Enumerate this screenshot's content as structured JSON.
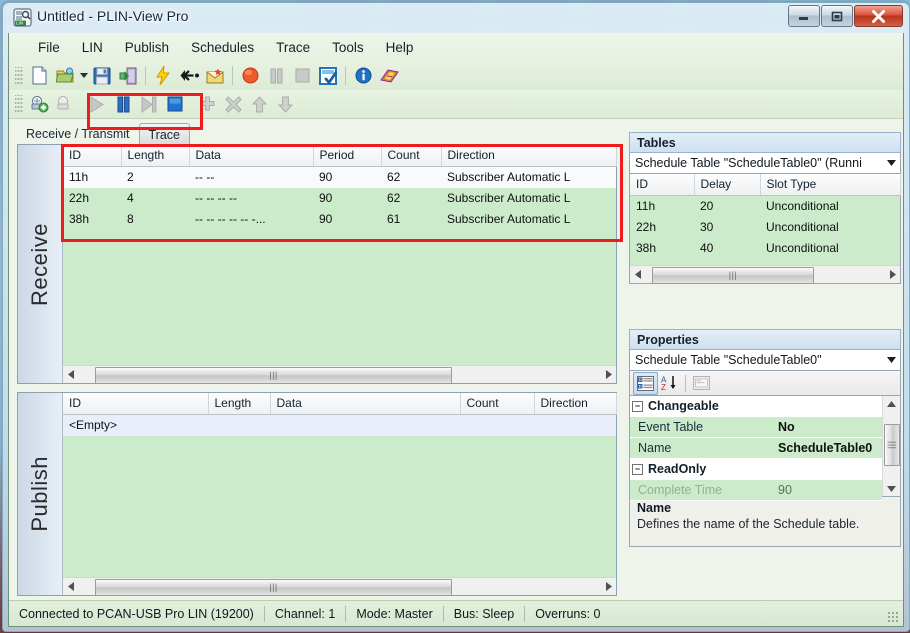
{
  "window": {
    "title": "Untitled - PLIN-View Pro",
    "app_icon": "plin-app-icon",
    "minimize_label": "Minimize",
    "maximize_label": "Maximize",
    "close_label": "Close"
  },
  "menubar": {
    "items": [
      {
        "label": "File"
      },
      {
        "label": "LIN"
      },
      {
        "label": "Publish"
      },
      {
        "label": "Schedules"
      },
      {
        "label": "Trace"
      },
      {
        "label": "Tools"
      },
      {
        "label": "Help"
      }
    ]
  },
  "toolbar_main": {
    "buttons": [
      {
        "icon": "new-document-icon",
        "label": "New"
      },
      {
        "icon": "open-folder-icon",
        "label": "Open"
      },
      {
        "icon": "open-dropdown-arrow-icon",
        "label": "Open recent"
      },
      {
        "icon": "save-floppy-icon",
        "label": "Save"
      },
      {
        "icon": "exit-door-icon",
        "label": "Exit"
      },
      {
        "icon": "connect-lightning-icon",
        "label": "Connect"
      },
      {
        "icon": "disconnect-arrow-icon",
        "label": "Disconnect"
      },
      {
        "icon": "message-envelope-icon",
        "label": "Messages"
      },
      {
        "icon": "record-circle-icon",
        "label": "Record"
      },
      {
        "icon": "pause-icon",
        "label": "Pause"
      },
      {
        "icon": "stop-icon",
        "label": "Stop"
      },
      {
        "icon": "clear-checklist-icon",
        "label": "Clear"
      },
      {
        "icon": "info-icon",
        "label": "Info"
      },
      {
        "icon": "help-book-icon",
        "label": "Help"
      }
    ]
  },
  "toolbar_schedule": {
    "buttons": [
      {
        "icon": "add-schedule-table-icon",
        "label": "Add schedule table"
      },
      {
        "icon": "remove-schedule-table-icon",
        "label": "Remove schedule table"
      },
      {
        "icon": "play-icon",
        "label": "Start schedule"
      },
      {
        "icon": "pause-icon",
        "label": "Pause schedule"
      },
      {
        "icon": "step-icon",
        "label": "Step schedule"
      },
      {
        "icon": "stop-icon",
        "label": "Stop schedule"
      },
      {
        "icon": "add-slot-icon",
        "label": "Add slot"
      },
      {
        "icon": "delete-slot-icon",
        "label": "Delete slot"
      },
      {
        "icon": "move-up-icon",
        "label": "Move up"
      },
      {
        "icon": "move-down-icon",
        "label": "Move down"
      }
    ]
  },
  "tabs": [
    {
      "label": "Receive / Transmit",
      "selected": true
    },
    {
      "label": "Trace",
      "selected": false
    }
  ],
  "receive": {
    "group_label": "Receive",
    "columns": [
      "ID",
      "Length",
      "Data",
      "Period",
      "Count",
      "Direction"
    ],
    "rows": [
      {
        "id": "11h",
        "length": "2",
        "data": "-- --",
        "period": "90",
        "count": "62",
        "direction": "Subscriber Automatic L"
      },
      {
        "id": "22h",
        "length": "4",
        "data": "-- -- -- --",
        "period": "90",
        "count": "62",
        "direction": "Subscriber Automatic L"
      },
      {
        "id": "38h",
        "length": "8",
        "data": "-- -- -- -- -- -...",
        "period": "90",
        "count": "61",
        "direction": "Subscriber Automatic L"
      }
    ],
    "scroll_left_icon": "scroll-left-arrow-icon",
    "scroll_right_icon": "scroll-right-arrow-icon"
  },
  "publish": {
    "group_label": "Publish",
    "columns": [
      "ID",
      "Length",
      "Data",
      "Count",
      "Direction"
    ],
    "empty_text": "<Empty>",
    "scroll_left_icon": "scroll-left-arrow-icon",
    "scroll_right_icon": "scroll-right-arrow-icon"
  },
  "tables_panel": {
    "title": "Tables",
    "selector_value": "Schedule Table \"ScheduleTable0\" (Runni",
    "dropdown_icon": "chevron-down-icon",
    "columns": [
      "ID",
      "Delay",
      "Slot Type"
    ],
    "rows": [
      {
        "id": "11h",
        "delay": "20",
        "slot_type": "Unconditional"
      },
      {
        "id": "22h",
        "delay": "30",
        "slot_type": "Unconditional"
      },
      {
        "id": "38h",
        "delay": "40",
        "slot_type": "Unconditional"
      }
    ]
  },
  "properties_panel": {
    "title": "Properties",
    "selector_value": "Schedule Table \"ScheduleTable0\"",
    "dropdown_icon": "chevron-down-icon",
    "toolbar": [
      {
        "icon": "categorized-view-icon",
        "label": "Categorized"
      },
      {
        "icon": "alphabetical-sort-icon",
        "label": "Alphabetical"
      },
      {
        "icon": "property-pages-icon",
        "label": "Property Pages"
      }
    ],
    "groups": [
      {
        "name": "Changeable",
        "expander": "collapse-icon",
        "rows": [
          {
            "name": "Event Table",
            "value": "No",
            "readonly": false
          },
          {
            "name": "Name",
            "value": "ScheduleTable0",
            "readonly": false
          }
        ]
      },
      {
        "name": "ReadOnly",
        "expander": "collapse-icon",
        "rows": [
          {
            "name": "Complete Time",
            "value": "90",
            "readonly": true
          }
        ]
      }
    ],
    "description_title": "Name",
    "description_text": "Defines the name of the Schedule table.",
    "scroll_up_icon": "scroll-up-arrow-icon",
    "scroll_down_icon": "scroll-down-arrow-icon"
  },
  "statusbar": {
    "cells": [
      "Connected to PCAN-USB Pro LIN (19200)",
      "Channel: 1",
      "Mode: Master",
      "Bus: Sleep",
      "Overruns: 0"
    ]
  },
  "colors": {
    "highlight_box": "#ee1c1c",
    "row_green": "#cbebcb",
    "panel_title": "#cfe0f0",
    "status_bg": "#d8e8d1"
  }
}
